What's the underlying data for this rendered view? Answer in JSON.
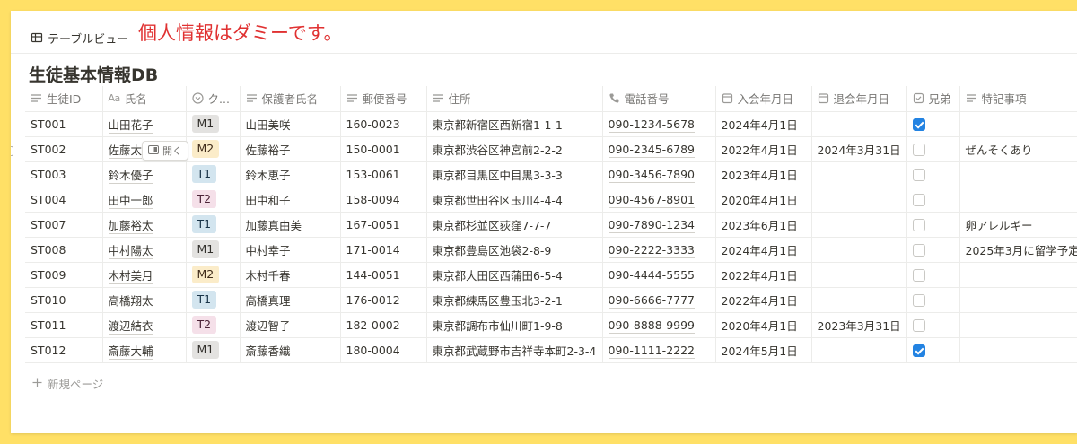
{
  "view": {
    "tab_label": "テーブルビュー",
    "note": "個人情報はダミーです。"
  },
  "database": {
    "title": "生徒基本情報DB"
  },
  "columns": [
    {
      "label": "生徒ID",
      "icon": "text-lines-icon"
    },
    {
      "label": "氏名",
      "icon": "title-aa-icon"
    },
    {
      "label": "ク...",
      "icon": "select-icon"
    },
    {
      "label": "保護者氏名",
      "icon": "text-lines-icon"
    },
    {
      "label": "郵便番号",
      "icon": "text-lines-icon"
    },
    {
      "label": "住所",
      "icon": "text-lines-icon"
    },
    {
      "label": "電話番号",
      "icon": "phone-icon"
    },
    {
      "label": "入会年月日",
      "icon": "calendar-icon"
    },
    {
      "label": "退会年月日",
      "icon": "calendar-icon"
    },
    {
      "label": "兄弟",
      "icon": "checkbox-icon"
    },
    {
      "label": "特記事項",
      "icon": "text-lines-icon"
    }
  ],
  "tag_colors": {
    "M1": {
      "bg": "#e3e2e0",
      "fg": "#32302c"
    },
    "M2": {
      "bg": "#fbecc9",
      "fg": "#402c1b"
    },
    "T1": {
      "bg": "#d3e5ef",
      "fg": "#183347"
    },
    "T2": {
      "bg": "#f5e0e9",
      "fg": "#4c2337"
    }
  },
  "rows": [
    {
      "id": "ST001",
      "name": "山田花子",
      "class": "M1",
      "guardian": "山田美咲",
      "zip": "160-0023",
      "address": "東京都新宿区西新宿1-1-1",
      "phone": "090-1234-5678",
      "joined": "2024年4月1日",
      "left": "",
      "sibling": true,
      "notes": ""
    },
    {
      "id": "ST002",
      "name": "佐藤太",
      "class": "M2",
      "guardian": "佐藤裕子",
      "zip": "150-0001",
      "address": "東京都渋谷区神宮前2-2-2",
      "phone": "090-2345-6789",
      "joined": "2022年4月1日",
      "left": "2024年3月31日",
      "sibling": false,
      "notes": "ぜんそくあり"
    },
    {
      "id": "ST003",
      "name": "鈴木優子",
      "class": "T1",
      "guardian": "鈴木恵子",
      "zip": "153-0061",
      "address": "東京都目黒区中目黒3-3-3",
      "phone": "090-3456-7890",
      "joined": "2023年4月1日",
      "left": "",
      "sibling": false,
      "notes": ""
    },
    {
      "id": "ST004",
      "name": "田中一郎",
      "class": "T2",
      "guardian": "田中和子",
      "zip": "158-0094",
      "address": "東京都世田谷区玉川4-4-4",
      "phone": "090-4567-8901",
      "joined": "2020年4月1日",
      "left": "",
      "sibling": false,
      "notes": ""
    },
    {
      "id": "ST007",
      "name": "加藤裕太",
      "class": "T1",
      "guardian": "加藤真由美",
      "zip": "167-0051",
      "address": "東京都杉並区荻窪7-7-7",
      "phone": "090-7890-1234",
      "joined": "2023年6月1日",
      "left": "",
      "sibling": false,
      "notes": "卵アレルギー"
    },
    {
      "id": "ST008",
      "name": "中村陽太",
      "class": "M1",
      "guardian": "中村幸子",
      "zip": "171-0014",
      "address": "東京都豊島区池袋2-8-9",
      "phone": "090-2222-3333",
      "joined": "2024年4月1日",
      "left": "",
      "sibling": false,
      "notes": "2025年3月に留学予定"
    },
    {
      "id": "ST009",
      "name": "木村美月",
      "class": "M2",
      "guardian": "木村千春",
      "zip": "144-0051",
      "address": "東京都大田区西蒲田6-5-4",
      "phone": "090-4444-5555",
      "joined": "2022年4月1日",
      "left": "",
      "sibling": false,
      "notes": ""
    },
    {
      "id": "ST010",
      "name": "高橋翔太",
      "class": "T1",
      "guardian": "高橋真理",
      "zip": "176-0012",
      "address": "東京都練馬区豊玉北3-2-1",
      "phone": "090-6666-7777",
      "joined": "2022年4月1日",
      "left": "",
      "sibling": false,
      "notes": ""
    },
    {
      "id": "ST011",
      "name": "渡辺結衣",
      "class": "T2",
      "guardian": "渡辺智子",
      "zip": "182-0002",
      "address": "東京都調布市仙川町1-9-8",
      "phone": "090-8888-9999",
      "joined": "2020年4月1日",
      "left": "2023年3月31日",
      "sibling": false,
      "notes": ""
    },
    {
      "id": "ST012",
      "name": "斎藤大輔",
      "class": "M1",
      "guardian": "斎藤香織",
      "zip": "180-0004",
      "address": "東京都武蔵野市吉祥寺本町2-3-4",
      "phone": "090-1111-2222",
      "joined": "2024年5月1日",
      "left": "",
      "sibling": true,
      "notes": ""
    }
  ],
  "row_hover": {
    "open_label": "開く"
  },
  "new_page_label": "新規ページ"
}
